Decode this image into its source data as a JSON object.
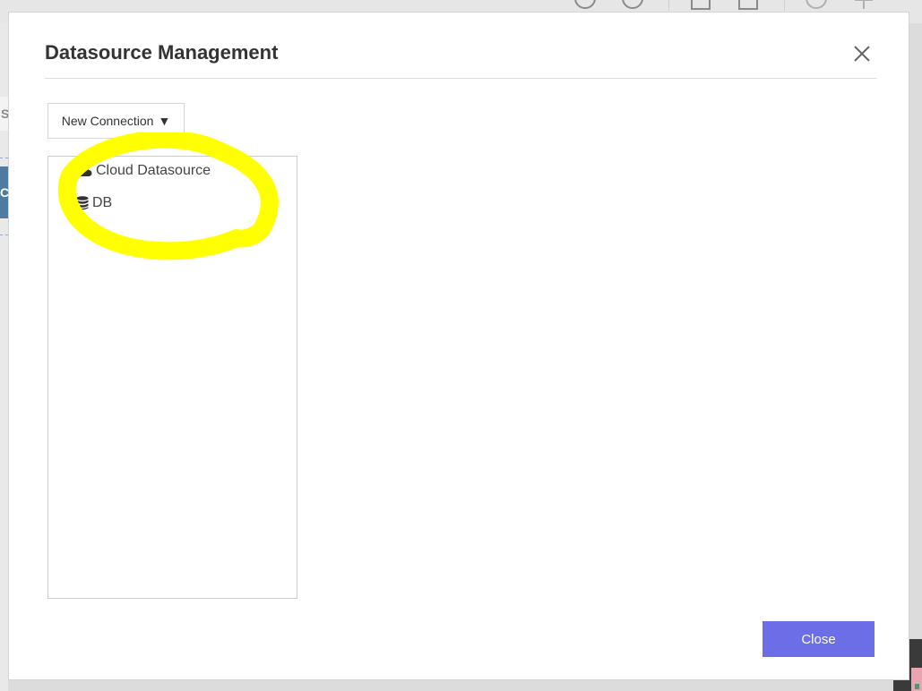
{
  "background": {
    "left_fragment_1": "S",
    "left_fragment_2": "C",
    "top_icons": [
      "info-circle-icon",
      "help-circle-icon",
      "checklist-icon",
      "print-settings-icon",
      "alert-circle-icon",
      "move-arrows-icon"
    ]
  },
  "modal": {
    "title": "Datasource Management",
    "new_connection_label": "New Connection",
    "new_connection_caret": "▼",
    "tree": [
      {
        "label": "Cloud Datasource",
        "icon": "cloud-icon"
      },
      {
        "label": "DB",
        "icon": "database-icon"
      }
    ],
    "close_button_label": "Close"
  },
  "colors": {
    "accent": "#6b6ee6",
    "highlight": "#ffff00",
    "background_panel": "#4f7ba0"
  }
}
